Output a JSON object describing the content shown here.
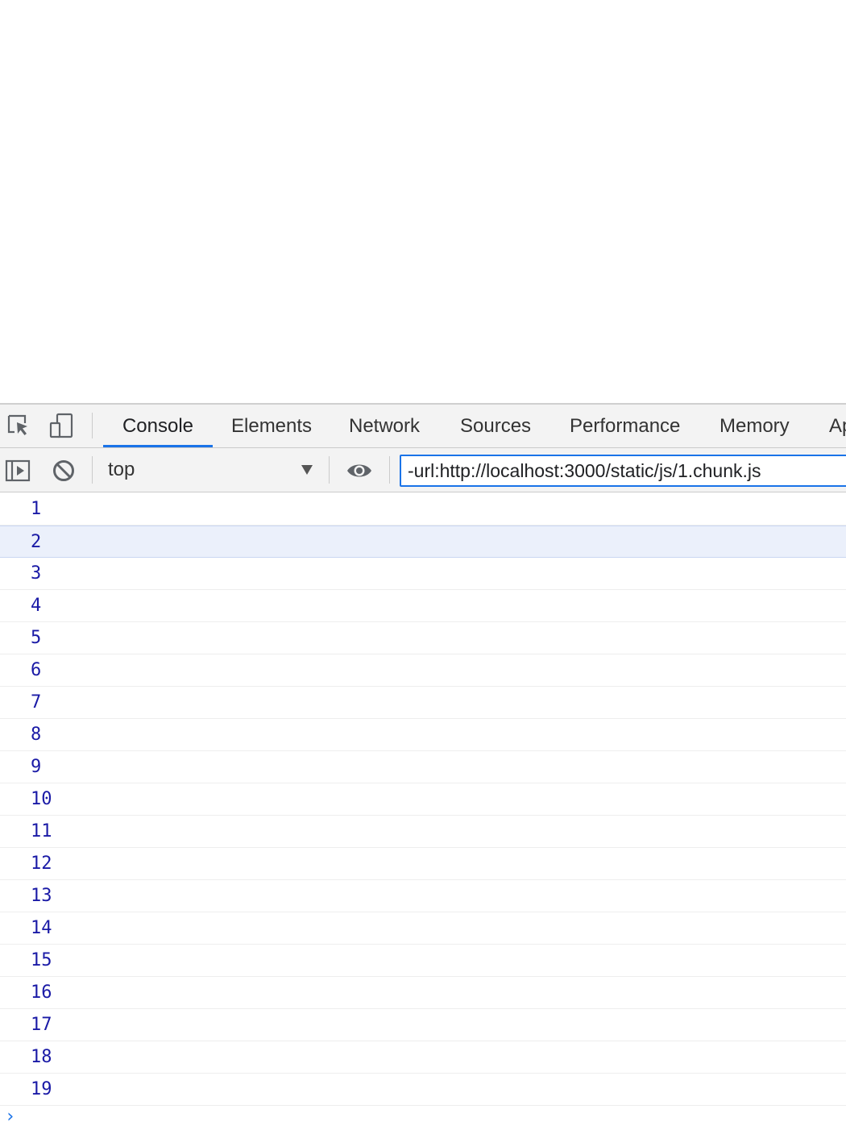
{
  "devtools": {
    "tabs": [
      {
        "label": "Console",
        "active": true
      },
      {
        "label": "Elements",
        "active": false
      },
      {
        "label": "Network",
        "active": false
      },
      {
        "label": "Sources",
        "active": false
      },
      {
        "label": "Performance",
        "active": false
      },
      {
        "label": "Memory",
        "active": false
      },
      {
        "label": "Ap",
        "active": false
      }
    ],
    "icons": {
      "inspect": "inspect-element-icon",
      "device": "device-toolbar-icon",
      "sidebar": "show-sidebar-icon",
      "clear": "clear-console-icon",
      "eye": "live-expression-icon"
    },
    "accent_color": "#1a73e8",
    "log_value_color": "#1a1aa6"
  },
  "toolbar": {
    "context": "top",
    "filter_value": "-url:http://localhost:3000/static/js/1.chunk.js"
  },
  "console": {
    "logs": [
      "1",
      "2",
      "3",
      "4",
      "5",
      "6",
      "7",
      "8",
      "9",
      "10",
      "11",
      "12",
      "13",
      "14",
      "15",
      "16",
      "17",
      "18",
      "19"
    ],
    "highlighted_index": 1,
    "prompt": "›"
  }
}
